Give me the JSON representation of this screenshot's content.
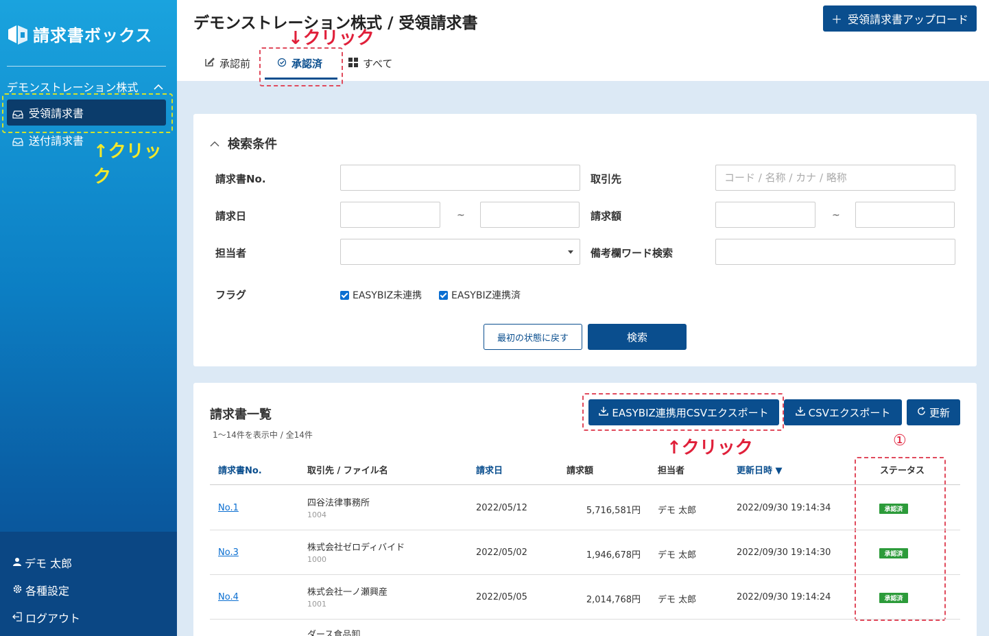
{
  "sidebar": {
    "logo_text": "請求書ボックス",
    "company": "デモンストレーション株式",
    "nav": [
      {
        "label": "受領請求書"
      },
      {
        "label": "送付請求書"
      }
    ],
    "annotation_click": "↑クリック",
    "user": "デモ 太郎",
    "settings": "各種設定",
    "logout": "ログアウト"
  },
  "header": {
    "title": "デモンストレーション株式 / 受領請求書",
    "upload_label": "受領請求書アップロード",
    "tabs": [
      {
        "label": "承認前"
      },
      {
        "label": "承認済"
      },
      {
        "label": "すべて"
      }
    ],
    "annotation_click": "↓クリック"
  },
  "search": {
    "title": "検索条件",
    "invoice_no_label": "請求書No.",
    "partner_label": "取引先",
    "partner_placeholder": "コード / 名称 / カナ / 略称",
    "date_label": "請求日",
    "amount_label": "請求額",
    "range_sep": "~",
    "assignee_label": "担当者",
    "memo_label": "備考欄ワード検索",
    "flag_label": "フラグ",
    "flags": [
      {
        "label": "EASYBIZ未連携"
      },
      {
        "label": "EASYBIZ連携済"
      }
    ],
    "reset_label": "最初の状態に戻す",
    "search_label": "検索"
  },
  "list": {
    "title": "請求書一覧",
    "count": "1〜14件を表示中 / 全14件",
    "easybiz_export_label": "EASYBIZ連携用CSVエクスポート",
    "csv_export_label": "CSVエクスポート",
    "refresh_label": "更新",
    "annotation_click": "↑クリック",
    "annotation_num": "①",
    "columns": {
      "no": "請求書No.",
      "partner": "取引先 / ファイル名",
      "date": "請求日",
      "amount": "請求額",
      "assignee": "担当者",
      "updated": "更新日時 ▼",
      "status": "ステータス"
    },
    "rows": [
      {
        "no": "No.1",
        "partner": "四谷法律事務所",
        "code": "1004",
        "date": "2022/05/12",
        "amount": "5,716,581円",
        "assignee": "デモ 太郎",
        "updated": "2022/09/30 19:14:34",
        "status": "承認済"
      },
      {
        "no": "No.3",
        "partner": "株式会社ゼロディバイド",
        "code": "1000",
        "date": "2022/05/02",
        "amount": "1,946,678円",
        "assignee": "デモ 太郎",
        "updated": "2022/09/30 19:14:30",
        "status": "承認済"
      },
      {
        "no": "No.4",
        "partner": "株式会社一ノ瀬興産",
        "code": "1001",
        "date": "2022/05/05",
        "amount": "2,014,768円",
        "assignee": "デモ 太郎",
        "updated": "2022/09/30 19:14:24",
        "status": "承認済"
      },
      {
        "partner": "ダース食品卸"
      }
    ]
  }
}
